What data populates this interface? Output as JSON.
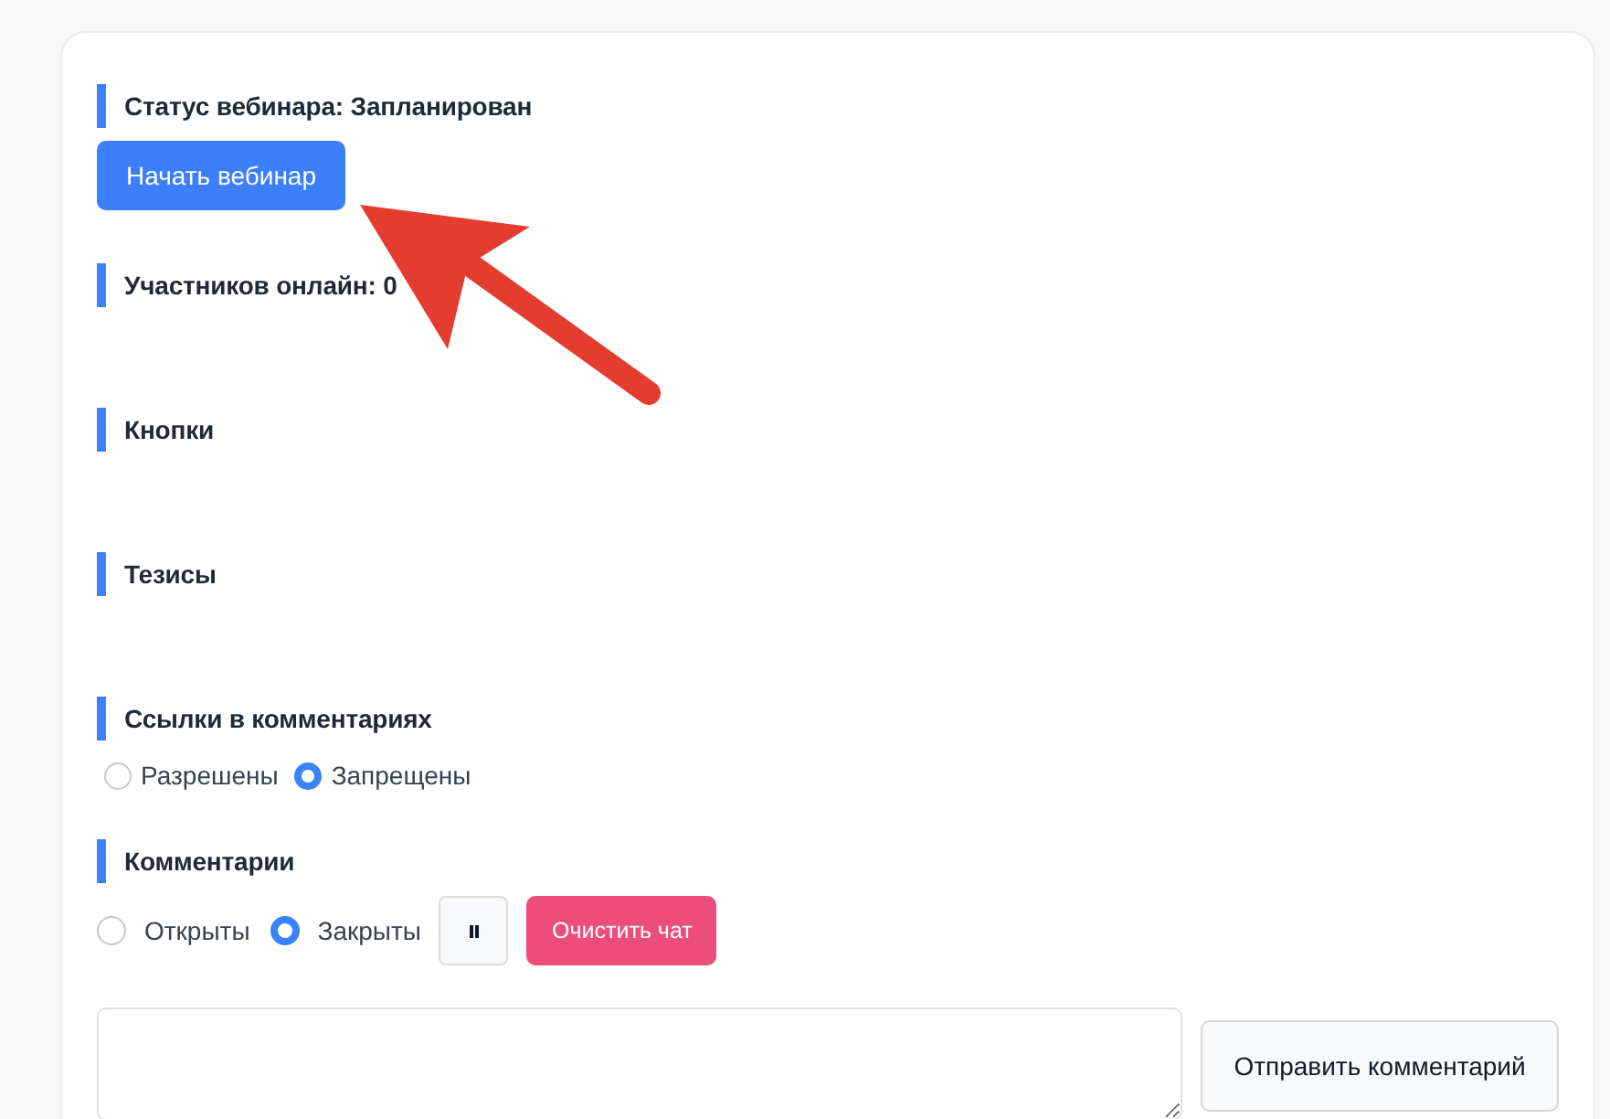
{
  "sections": [
    {
      "kind": "status",
      "title": "Статус вебинара: Запланирован",
      "button": "Начать вебинар"
    },
    {
      "kind": "plain",
      "title": "Участников онлайн: 0"
    },
    {
      "kind": "plain",
      "title": "Кнопки"
    },
    {
      "kind": "plain",
      "title": "Тезисы"
    },
    {
      "kind": "links",
      "title": "Ссылки в комментариях",
      "options": [
        {
          "label": "Разрешены",
          "selected": false
        },
        {
          "label": "Запрещены",
          "selected": true
        }
      ]
    },
    {
      "kind": "comments",
      "title": "Комментарии",
      "options": [
        {
          "label": "Открыты",
          "selected": false
        },
        {
          "label": "Закрыты",
          "selected": true
        }
      ],
      "clear_button": "Очистить чат"
    }
  ],
  "comment_form": {
    "send_button": "Отправить комментарий"
  }
}
